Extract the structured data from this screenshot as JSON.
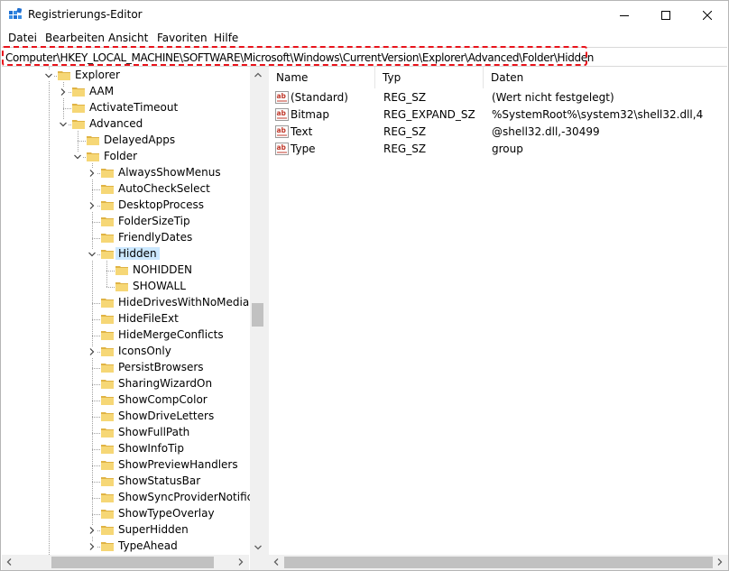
{
  "window": {
    "title": "Registrierungs-Editor",
    "icon": "regedit-icon"
  },
  "menu": {
    "items": [
      "Datei",
      "Bearbeiten",
      "Ansicht",
      "Favoriten",
      "Hilfe"
    ]
  },
  "address": {
    "path": "Computer\\HKEY_LOCAL_MACHINE\\SOFTWARE\\Microsoft\\Windows\\CurrentVersion\\Explorer\\Advanced\\Folder\\Hidden",
    "highlight_color": "#e8131b"
  },
  "tree": {
    "items": [
      {
        "label": "Explorer",
        "depth": 0,
        "expander": "expanded",
        "selected": false
      },
      {
        "label": "AAM",
        "depth": 1,
        "expander": "collapsed",
        "selected": false
      },
      {
        "label": "ActivateTimeout",
        "depth": 1,
        "expander": "none",
        "selected": false
      },
      {
        "label": "Advanced",
        "depth": 1,
        "expander": "expanded",
        "selected": false
      },
      {
        "label": "DelayedApps",
        "depth": 2,
        "expander": "none",
        "selected": false
      },
      {
        "label": "Folder",
        "depth": 2,
        "expander": "expanded",
        "selected": false
      },
      {
        "label": "AlwaysShowMenus",
        "depth": 3,
        "expander": "collapsed",
        "selected": false
      },
      {
        "label": "AutoCheckSelect",
        "depth": 3,
        "expander": "none",
        "selected": false
      },
      {
        "label": "DesktopProcess",
        "depth": 3,
        "expander": "collapsed",
        "selected": false
      },
      {
        "label": "FolderSizeTip",
        "depth": 3,
        "expander": "none",
        "selected": false
      },
      {
        "label": "FriendlyDates",
        "depth": 3,
        "expander": "none",
        "selected": false
      },
      {
        "label": "Hidden",
        "depth": 3,
        "expander": "expanded",
        "selected": true
      },
      {
        "label": "NOHIDDEN",
        "depth": 4,
        "expander": "none",
        "selected": false
      },
      {
        "label": "SHOWALL",
        "depth": 4,
        "expander": "none",
        "selected": false
      },
      {
        "label": "HideDrivesWithNoMedia",
        "depth": 3,
        "expander": "none",
        "selected": false
      },
      {
        "label": "HideFileExt",
        "depth": 3,
        "expander": "none",
        "selected": false
      },
      {
        "label": "HideMergeConflicts",
        "depth": 3,
        "expander": "none",
        "selected": false
      },
      {
        "label": "IconsOnly",
        "depth": 3,
        "expander": "collapsed",
        "selected": false
      },
      {
        "label": "PersistBrowsers",
        "depth": 3,
        "expander": "none",
        "selected": false
      },
      {
        "label": "SharingWizardOn",
        "depth": 3,
        "expander": "none",
        "selected": false
      },
      {
        "label": "ShowCompColor",
        "depth": 3,
        "expander": "none",
        "selected": false
      },
      {
        "label": "ShowDriveLetters",
        "depth": 3,
        "expander": "none",
        "selected": false
      },
      {
        "label": "ShowFullPath",
        "depth": 3,
        "expander": "none",
        "selected": false
      },
      {
        "label": "ShowInfoTip",
        "depth": 3,
        "expander": "none",
        "selected": false
      },
      {
        "label": "ShowPreviewHandlers",
        "depth": 3,
        "expander": "none",
        "selected": false
      },
      {
        "label": "ShowStatusBar",
        "depth": 3,
        "expander": "none",
        "selected": false
      },
      {
        "label": "ShowSyncProviderNotificat",
        "depth": 3,
        "expander": "none",
        "selected": false
      },
      {
        "label": "ShowTypeOverlay",
        "depth": 3,
        "expander": "none",
        "selected": false
      },
      {
        "label": "SuperHidden",
        "depth": 3,
        "expander": "collapsed",
        "selected": false
      },
      {
        "label": "TypeAhead",
        "depth": 3,
        "expander": "collapsed",
        "selected": false
      }
    ]
  },
  "values": {
    "columns": [
      "Name",
      "Typ",
      "Daten"
    ],
    "rows": [
      {
        "name": "(Standard)",
        "type": "REG_SZ",
        "data": "(Wert nicht festgelegt)",
        "icon": "string-value-icon"
      },
      {
        "name": "Bitmap",
        "type": "REG_EXPAND_SZ",
        "data": "%SystemRoot%\\system32\\shell32.dll,4",
        "icon": "string-value-icon"
      },
      {
        "name": "Text",
        "type": "REG_SZ",
        "data": "@shell32.dll,-30499",
        "icon": "string-value-icon"
      },
      {
        "name": "Type",
        "type": "REG_SZ",
        "data": "group",
        "icon": "string-value-icon"
      }
    ]
  },
  "colors": {
    "folder": "#f6d776",
    "folder_dark": "#e0b344",
    "selection": "#cce8ff",
    "value_icon_red": "#c0392b"
  }
}
